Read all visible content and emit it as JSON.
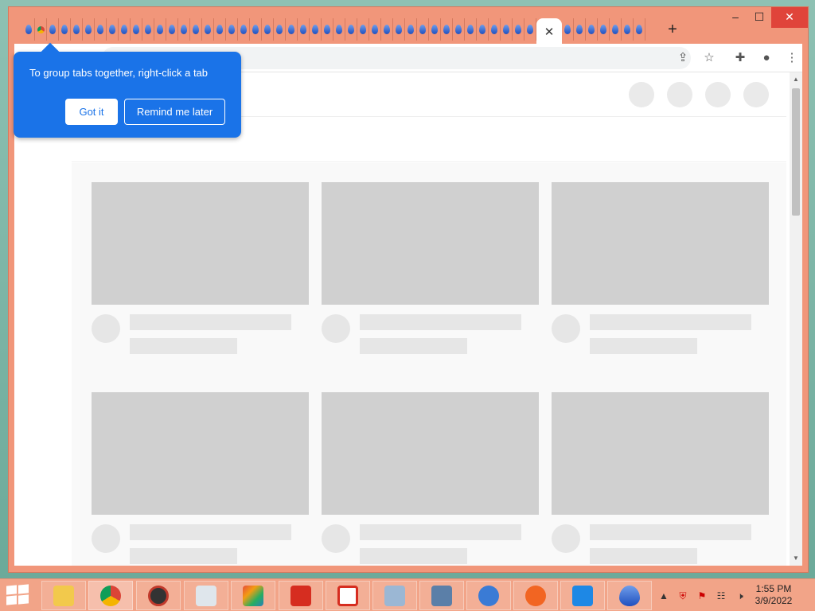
{
  "browser": {
    "active_tab_close": "✕",
    "new_tab": "+",
    "controls": {
      "minimize": "‒",
      "maximize": "☐",
      "close": "✕"
    },
    "toolbar": {
      "share_icon": "share-icon",
      "bookmark_icon": "star-icon",
      "extensions_icon": "puzzle-icon",
      "profile_icon": "profile-icon",
      "menu_icon": "kebab-menu-icon"
    }
  },
  "bubble": {
    "text": "To group tabs together, right-click a tab",
    "got_it": "Got it",
    "remind_later": "Remind me later"
  },
  "taskbar": {
    "time": "1:55 PM",
    "date": "3/9/2022",
    "tray_arrow": "▲"
  },
  "colors": {
    "window_frame": "#f1967a",
    "bubble": "#1a73e8",
    "placeholder": "#d0d0d0"
  }
}
